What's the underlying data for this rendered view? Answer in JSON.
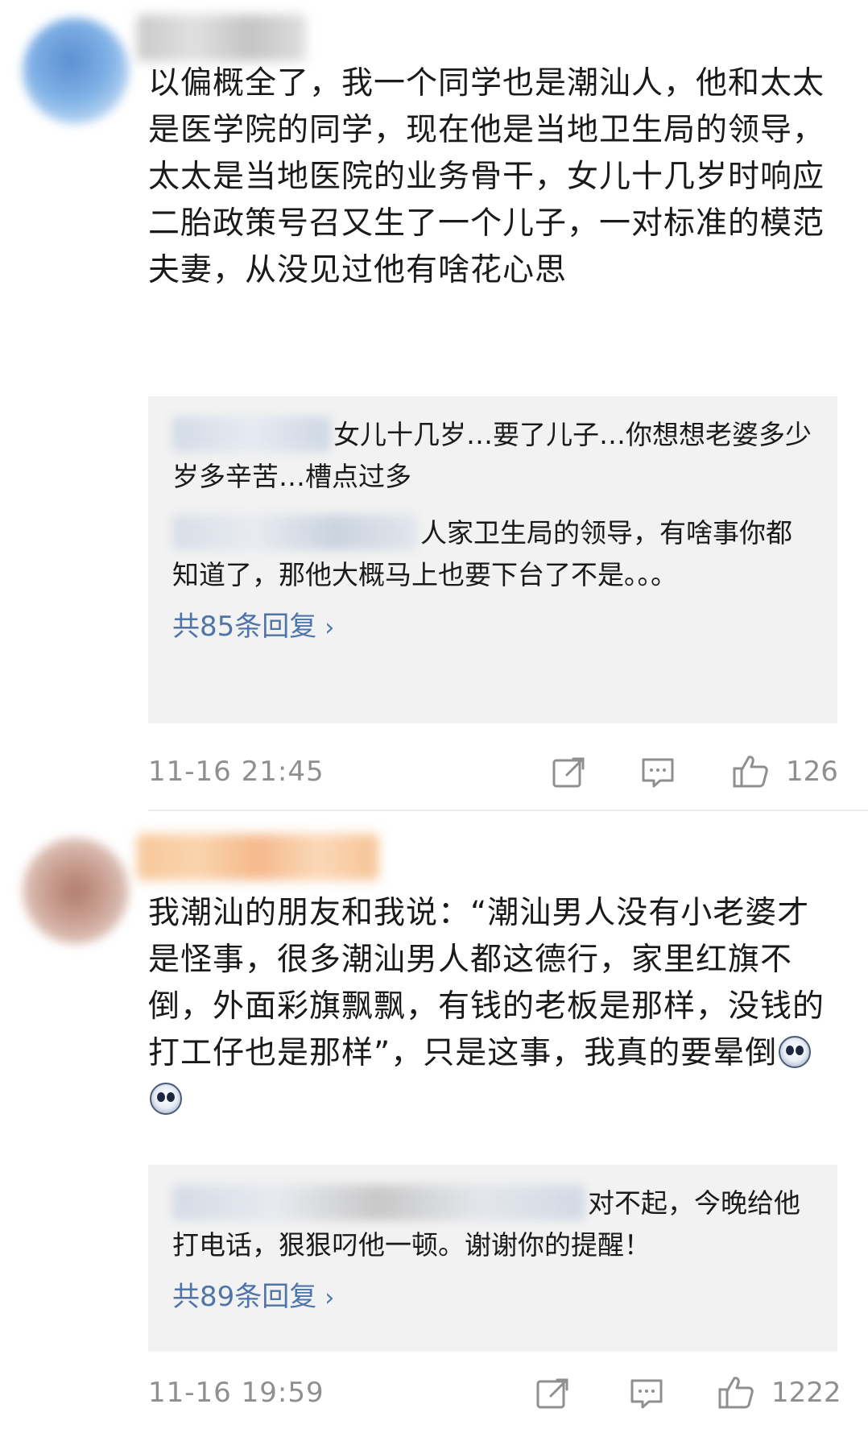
{
  "comments": [
    {
      "text": "以偏概全了，我一个同学也是潮汕人，他和太太是医学院的同学，现在他是当地卫生局的领导，太太是当地医院的业务骨干，女儿十几岁时响应二胎政策号召又生了一个儿子，一对标准的模范夫妻，从没见过他有啥花心思",
      "replies": [
        "女儿十几岁…要了儿子…你想想老婆多少岁多辛苦…槽点过多",
        "人家卫生局的领导，有啥事你都知道了，那他大概马上也要下台了不是。。。"
      ],
      "more_replies": "共85条回复",
      "timestamp": "11-16 21:45",
      "likes": "126"
    },
    {
      "text": "我潮汕的朋友和我说：“潮汕男人没有小老婆才是怪事，很多潮汕男人都这德行，家里红旗不倒，外面彩旗飘飘，有钱的老板是那样，没钱的打工仔也是那样”，只是这事，我真的要晕倒",
      "emoji_icons": [
        "dizzy-face-icon",
        "dizzy-face-icon"
      ],
      "replies": [
        "对不起，今晚给他打电话，狠狠叼他一顿。谢谢你的提醒！"
      ],
      "more_replies": "共89条回复",
      "timestamp": "11-16 19:59",
      "likes": "1222"
    }
  ],
  "icons": {
    "share": "share-icon",
    "comment": "comment-icon",
    "like": "thumbs-up-icon"
  },
  "colors": {
    "link": "#4f75a8",
    "meta": "#8f8f8f",
    "reply_bg": "#f2f2f2"
  }
}
